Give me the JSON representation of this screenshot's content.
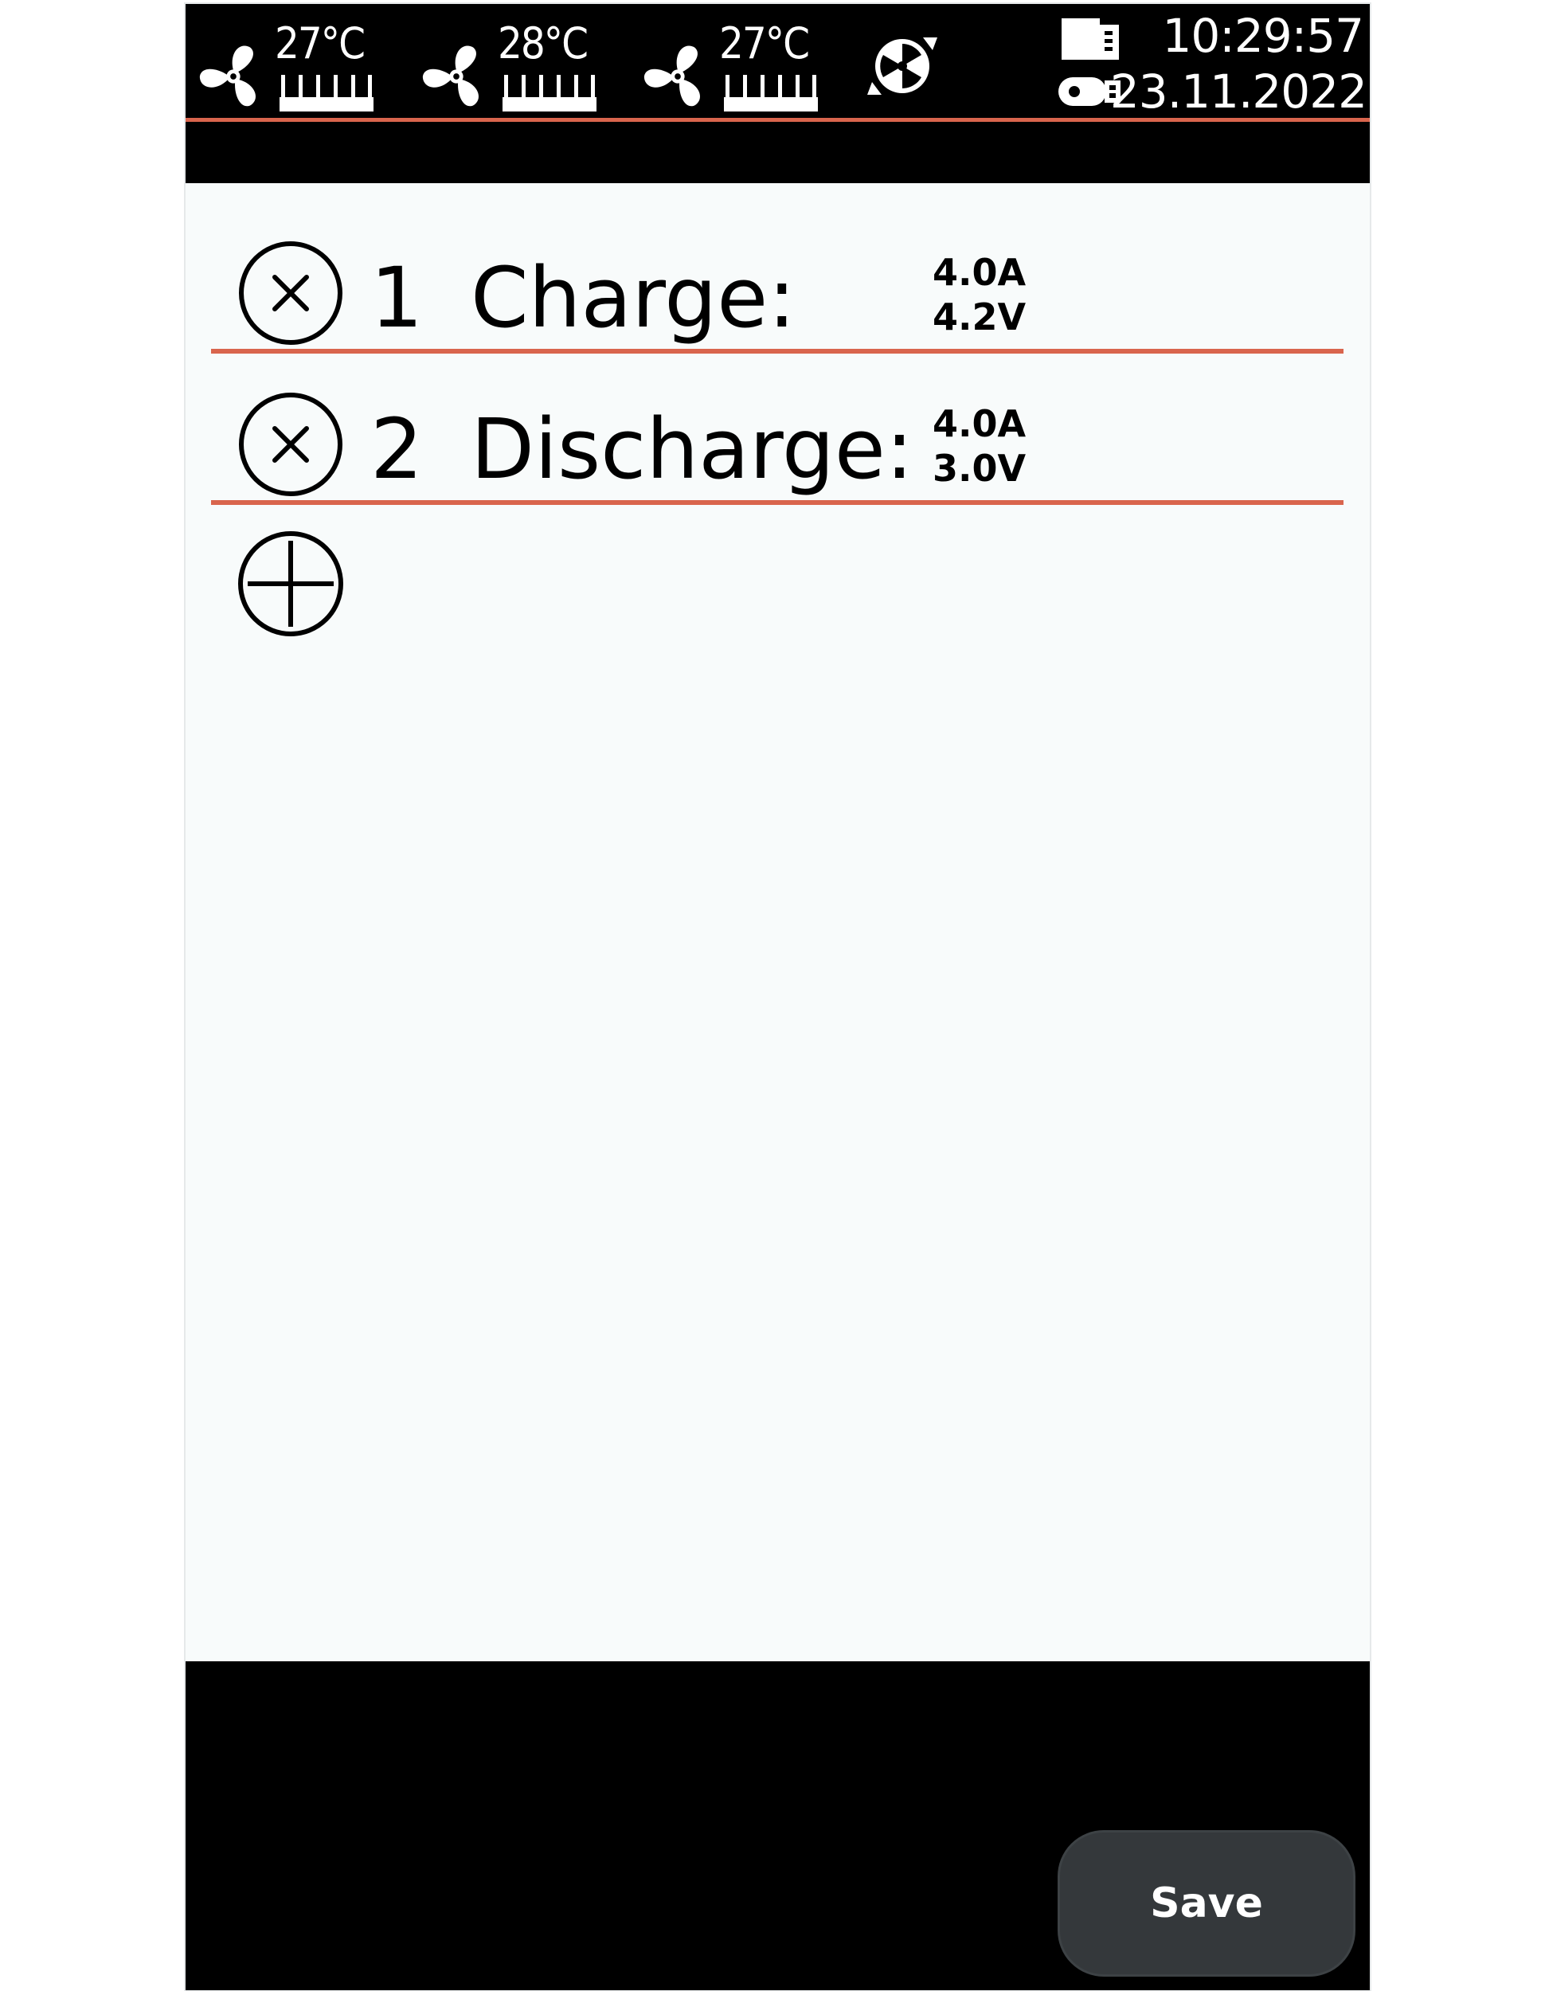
{
  "status_bar": {
    "sensors": [
      {
        "temperature": "27°C",
        "icon": "fan-icon"
      },
      {
        "temperature": "28°C",
        "icon": "fan-icon"
      },
      {
        "temperature": "27°C",
        "icon": "fan-icon"
      }
    ],
    "time": "10:29:57",
    "date": "23.11.2022"
  },
  "steps": [
    {
      "number": "1",
      "name": "Charge:",
      "current": "4.0A",
      "voltage": "4.2V",
      "icon": "remove-circle-icon"
    },
    {
      "number": "2",
      "name": "Discharge:",
      "current": "4.0A",
      "voltage": "3.0V",
      "icon": "remove-circle-icon"
    }
  ],
  "add_step_icon": "add-circle-icon",
  "footer": {
    "save_label": "Save"
  },
  "colors": {
    "accent": "#d9654d",
    "bar_background": "#000000",
    "content_background": "#f8fbfb",
    "button_background": "#34383b"
  }
}
